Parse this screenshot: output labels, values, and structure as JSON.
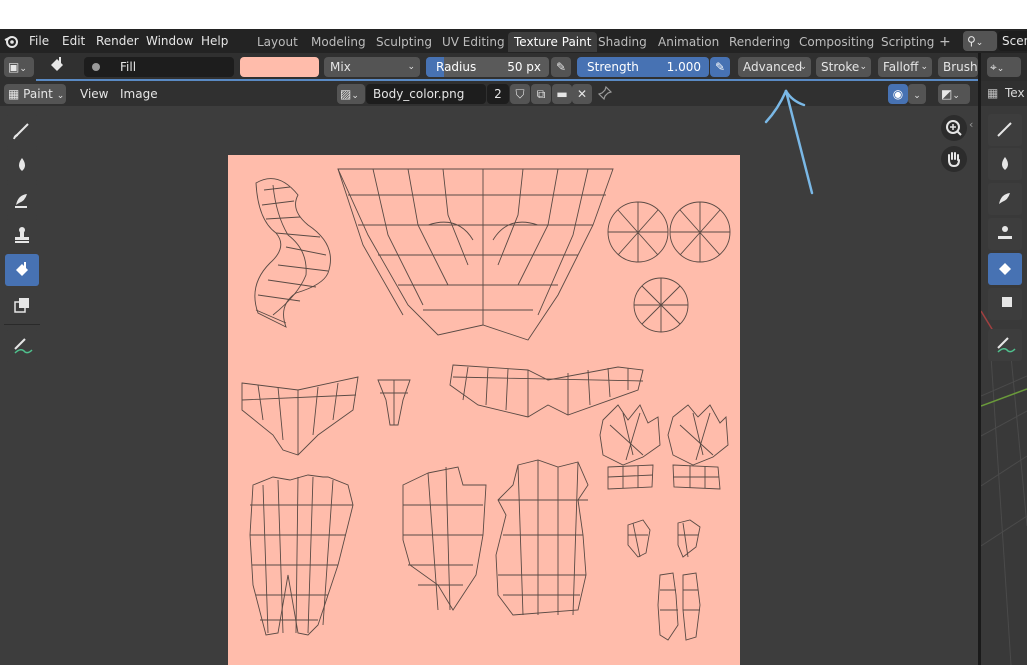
{
  "menu": {
    "items": [
      "File",
      "Edit",
      "Render",
      "Window",
      "Help"
    ]
  },
  "workspaces": {
    "tabs": [
      "Layout",
      "Modeling",
      "Sculpting",
      "UV Editing",
      "Texture Paint",
      "Shading",
      "Animation",
      "Rendering",
      "Compositing",
      "Scripting"
    ],
    "active": "Texture Paint",
    "add_label": "+"
  },
  "scene": {
    "label": "Scen"
  },
  "tool_header": {
    "brush_name": "Fill",
    "color_hex": "#ffbcab",
    "blend_mode": "Mix",
    "radius_label": "Radius",
    "radius_value": "50 px",
    "strength_label": "Strength",
    "strength_value": "1.000",
    "advanced_label": "Advanced",
    "stroke_label": "Stroke",
    "falloff_label": "Falloff",
    "brush_label": "Brush"
  },
  "editor_header": {
    "mode_label": "Paint",
    "view_label": "View",
    "image_label": "Image",
    "image_name": "Body_color.png",
    "user_count": "2"
  },
  "right_panel": {
    "text_label": "Tex"
  },
  "colors": {
    "accent": "#4772b3",
    "canvas": "#ffbcab",
    "annotation": "#7ab8e6"
  },
  "icons": {
    "toolbar": [
      "brush-icon",
      "smear-icon",
      "clone-icon",
      "stamp-icon",
      "fill-icon",
      "mask-icon",
      "annotate-icon"
    ],
    "nav": [
      "zoom-icon",
      "pan-hand-icon"
    ]
  }
}
